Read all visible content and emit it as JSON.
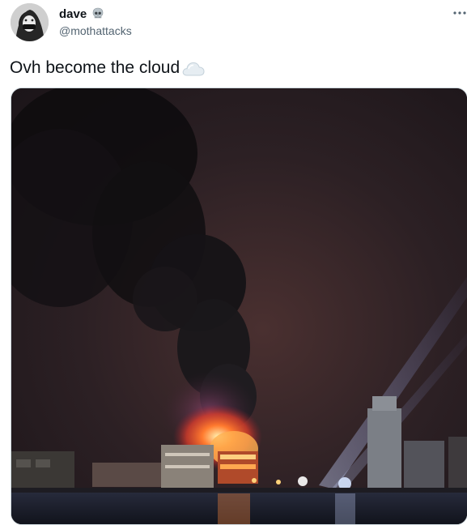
{
  "tweet": {
    "author": {
      "display_name": "dave",
      "badge_icon": "skull-icon",
      "handle": "@mothattacks"
    },
    "more_icon": "more-options-icon",
    "text": "Ovh become the cloud",
    "emoji_icon": "cloud-icon",
    "media": {
      "kind": "photo"
    }
  },
  "colors": {
    "text_primary": "#0f1419",
    "text_secondary": "#536471",
    "border": "#cfd9de"
  }
}
